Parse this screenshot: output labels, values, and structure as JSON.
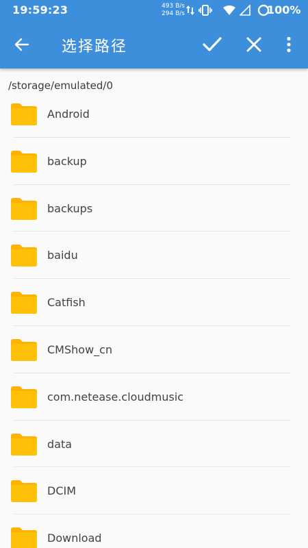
{
  "status_bar": {
    "time": "19:59:23",
    "upload_speed": "493 B/s",
    "download_speed": "294 B/s",
    "battery_percent": "100%",
    "icons": [
      "data-transfer-icon",
      "vibrate-icon",
      "wifi-icon",
      "no-signal-icon",
      "battery-ring-icon"
    ]
  },
  "app_bar": {
    "title": "选择路径",
    "back_icon": "arrow-back-icon",
    "confirm_icon": "check-icon",
    "close_icon": "close-icon",
    "more_icon": "more-vert-icon",
    "background_color": "#3d8fdb"
  },
  "path": "/storage/emulated/0",
  "folders": [
    {
      "name": "Android"
    },
    {
      "name": "backup"
    },
    {
      "name": "backups"
    },
    {
      "name": "baidu"
    },
    {
      "name": "Catfish"
    },
    {
      "name": "CMShow_cn"
    },
    {
      "name": "com.netease.cloudmusic"
    },
    {
      "name": "data"
    },
    {
      "name": "DCIM"
    },
    {
      "name": "Download"
    }
  ],
  "folder_icon": "folder-icon",
  "folder_color": "#ffc107"
}
